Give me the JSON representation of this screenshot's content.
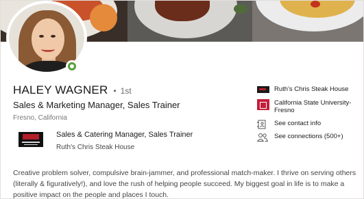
{
  "profile": {
    "name": "HALEY WAGNER",
    "degree": "1st",
    "headline": "Sales & Marketing Manager, Sales Trainer",
    "location": "Fresno, California",
    "online_status": "online"
  },
  "current_position": {
    "title": "Sales & Catering Manager, Sales Trainer",
    "company": "Ruth's Chris Steak House"
  },
  "sidebar": {
    "company": "Ruth's Chris Steak House",
    "school": "California State University-Fresno",
    "contact_info": "See contact info",
    "connections": "See connections (500+)"
  },
  "about": {
    "text": "Creative problem solver, compulsive brain-jammer, and professional match-maker. I thrive on serving others (literally & figuratively!), and love the rush of helping people succeed. My biggest goal in life is to make a positive impact on the people and places I touch."
  },
  "colors": {
    "online_green": "#5a9e3a",
    "school_red": "#c41e3a",
    "brand_red": "#b21e2a"
  },
  "icons": [
    "company-logo-icon",
    "school-logo-icon",
    "contact-card-icon",
    "connections-people-icon",
    "online-status-icon"
  ]
}
